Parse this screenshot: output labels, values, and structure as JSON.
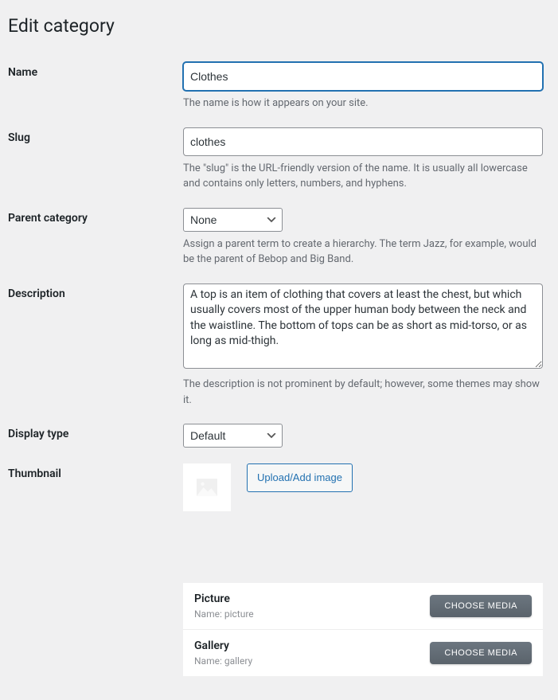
{
  "page_title": "Edit category",
  "fields": {
    "name": {
      "label": "Name",
      "value": "Clothes",
      "help": "The name is how it appears on your site."
    },
    "slug": {
      "label": "Slug",
      "value": "clothes",
      "help": "The \"slug\" is the URL-friendly version of the name. It is usually all lowercase and contains only letters, numbers, and hyphens."
    },
    "parent": {
      "label": "Parent category",
      "selected": "None",
      "help": "Assign a parent term to create a hierarchy. The term Jazz, for example, would be the parent of Bebop and Big Band."
    },
    "description": {
      "label": "Description",
      "value": "A top is an item of clothing that covers at least the chest, but which usually covers most of the upper human body between the neck and the waistline. The bottom of tops can be as short as mid-torso, or as long as mid-thigh.",
      "help": "The description is not prominent by default; however, some themes may show it."
    },
    "display_type": {
      "label": "Display type",
      "selected": "Default"
    },
    "thumbnail": {
      "label": "Thumbnail",
      "button": "Upload/Add image"
    }
  },
  "media_fields": [
    {
      "title": "Picture",
      "name_label": "Name: picture",
      "button": "CHOOSE MEDIA"
    },
    {
      "title": "Gallery",
      "name_label": "Name: gallery",
      "button": "CHOOSE MEDIA"
    }
  ]
}
